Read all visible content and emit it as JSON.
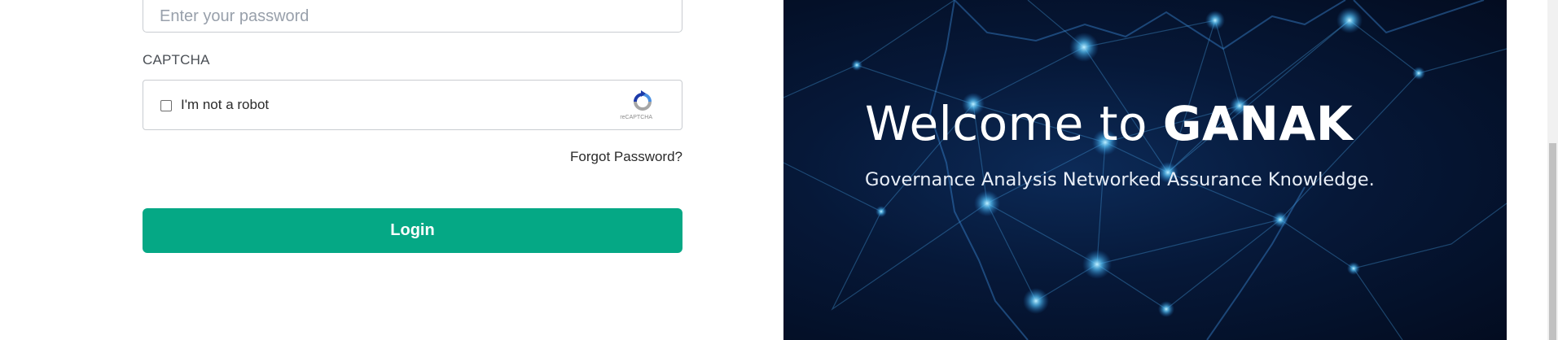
{
  "login_form": {
    "password": {
      "value": "",
      "placeholder": "Enter your password"
    },
    "captcha": {
      "label": "CAPTCHA",
      "checkbox_label": "I'm not a robot",
      "checked": false,
      "caption": "reCAPTCHA",
      "icon": "recaptcha-icon"
    },
    "forgot_password": "Forgot Password?",
    "login_button": "Login"
  },
  "banner": {
    "title_prefix": "Welcome to ",
    "title_brand": "GANAK",
    "subtitle": "Governance Analysis Networked Assurance Knowledge."
  },
  "colors": {
    "accent": "#05a885",
    "banner_background": "#061838",
    "node_glow": "#56c7ff"
  }
}
